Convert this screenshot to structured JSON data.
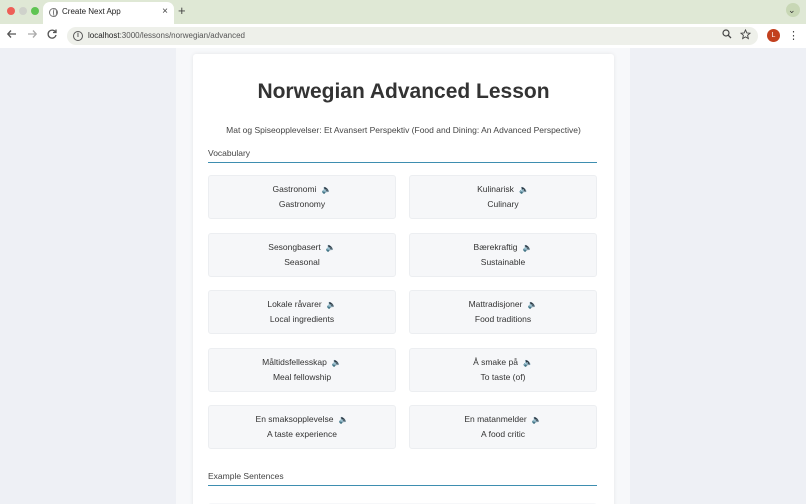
{
  "browser": {
    "tab_title": "Create Next App",
    "tab_close": "×",
    "new_tab": "+",
    "tabs_menu": "⌄",
    "url_host": "localhost",
    "url_path": ":3000/lessons/norwegian/advanced",
    "avatar_letter": "L",
    "icons": [
      "back-icon",
      "forward-icon",
      "reload-icon",
      "info-icon",
      "zoom-icon",
      "bookmark-star-icon",
      "menu-icon"
    ]
  },
  "lesson": {
    "title": "Norwegian Advanced Lesson",
    "subtitle": "Mat og Spiseopplevelser: Et Avansert Perspektiv (Food and Dining: An Advanced Perspective)",
    "vocab_heading": "Vocabulary",
    "examples_heading": "Example Sentences",
    "speaker_glyph": "🔈",
    "vocabulary": [
      {
        "word": "Gastronomi",
        "translation": "Gastronomy"
      },
      {
        "word": "Kulinarisk",
        "translation": "Culinary"
      },
      {
        "word": "Sesongbasert",
        "translation": "Seasonal"
      },
      {
        "word": "Bærekraftig",
        "translation": "Sustainable"
      },
      {
        "word": "Lokale råvarer",
        "translation": "Local ingredients"
      },
      {
        "word": "Mattradisjoner",
        "translation": "Food traditions"
      },
      {
        "word": "Måltidsfellesskap",
        "translation": "Meal fellowship"
      },
      {
        "word": "Å smake på",
        "translation": "To taste (of)"
      },
      {
        "word": "En smaksopplevelse",
        "translation": "A taste experience"
      },
      {
        "word": "En matanmelder",
        "translation": "A food critic"
      }
    ]
  }
}
